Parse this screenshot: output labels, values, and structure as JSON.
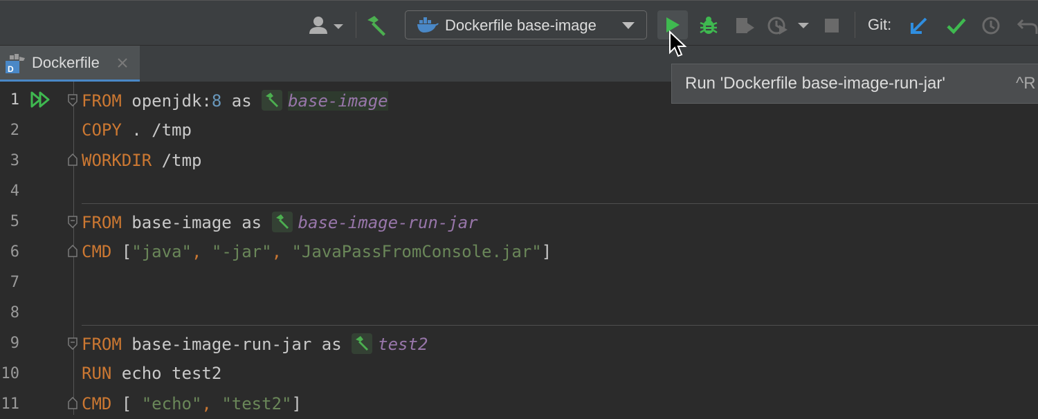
{
  "toolbar": {
    "run_config_label": "Dockerfile base-image",
    "git_label": "Git:",
    "icons": [
      "user-icon",
      "build-hammer-icon",
      "docker-icon",
      "run-icon",
      "debug-icon",
      "coverage-icon",
      "profile-icon",
      "stop-icon",
      "git-update-icon",
      "git-commit-icon",
      "git-history-icon",
      "git-rollback-icon"
    ]
  },
  "tabs": [
    {
      "label": "Dockerfile",
      "icon": "dockerfile-icon",
      "active": true
    }
  ],
  "tooltip": {
    "text": "Run 'Dockerfile base-image-run-jar'",
    "shortcut": "^R"
  },
  "editor": {
    "line_numbers": [
      "1",
      "2",
      "3",
      "4",
      "5",
      "6",
      "7",
      "8",
      "9",
      "10",
      "11"
    ],
    "lines": [
      {
        "kw": "FROM",
        "text": " openjdk:",
        "num": "8",
        "text2": " as ",
        "alias": "base-image"
      },
      {
        "kw": "COPY",
        "text": " . /tmp"
      },
      {
        "kw": "WORKDIR",
        "text": " /tmp"
      },
      {
        "text": ""
      },
      {
        "kw": "FROM",
        "text": " base-image as ",
        "alias": "base-image-run-jar"
      },
      {
        "kw": "CMD",
        "text": " [",
        "s1": "\"java\"",
        "c1": ", ",
        "s2": "\"-jar\"",
        "c2": ", ",
        "s3": "\"JavaPassFromConsole.jar\"",
        "end": "]"
      },
      {
        "text": ""
      },
      {
        "text": ""
      },
      {
        "kw": "FROM",
        "text": " base-image-run-jar as ",
        "alias": "test2"
      },
      {
        "kw": "RUN",
        "text": " echo test2"
      },
      {
        "kw": "CMD",
        "text": " [ ",
        "s1": "\"echo\"",
        "c1": ", ",
        "s2": "\"test2\"",
        "end": "]"
      }
    ]
  },
  "colors": {
    "keyword": "#cc7832",
    "string": "#6a8759",
    "alias": "#9876aa",
    "run_green": "#3fb950",
    "git_blue": "#2f8ee0"
  }
}
